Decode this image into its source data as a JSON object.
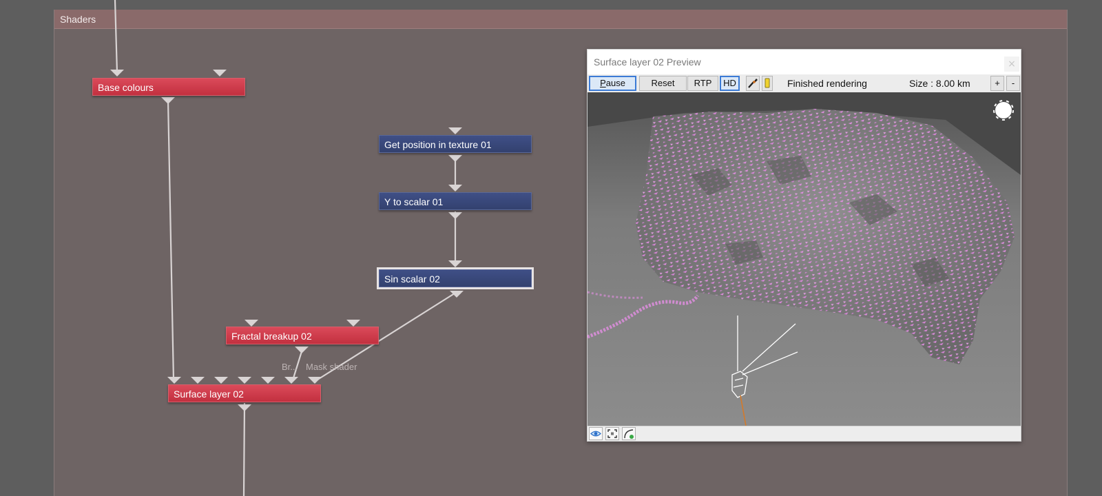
{
  "panel": {
    "title": "Shaders"
  },
  "nodes": {
    "base_colours": "Base colours",
    "get_position": "Get position in texture 01",
    "y_to_scalar": "Y to scalar 01",
    "sin_scalar": "Sin scalar 02",
    "fractal_breakup": "Fractal breakup 02",
    "surface_layer": "Surface layer 02"
  },
  "edge_labels": {
    "br": "Br...",
    "mask": "Mask shader"
  },
  "preview": {
    "title": "Surface layer 02 Preview",
    "close": "×",
    "toolbar": {
      "pause_u": "P",
      "pause_rest": "ause",
      "reset": "Reset",
      "rtp": "RTP",
      "hd": "HD",
      "status": "Finished rendering",
      "size": "Size :  8.00 km",
      "zoom_in": "+",
      "zoom_out": "-"
    },
    "icons": [
      "paint-brush-icon",
      "light-bulb-icon",
      "eye-icon",
      "frame-icon",
      "curve-icon"
    ],
    "colors": {
      "terrain_mask": "#e48fe4",
      "selected_button": "#3b7bd6"
    }
  }
}
